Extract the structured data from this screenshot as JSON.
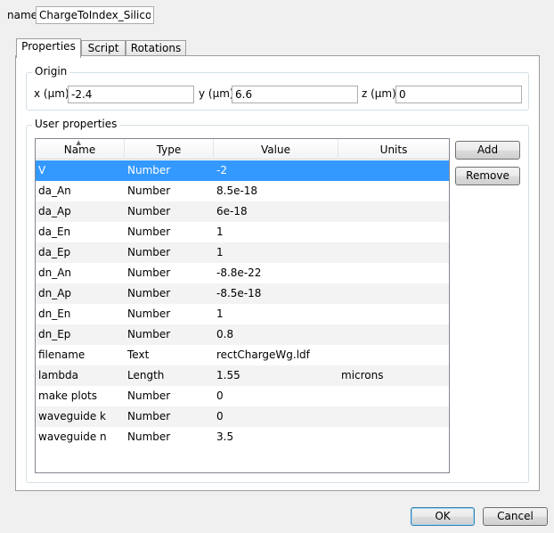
{
  "name": {
    "label": "name",
    "value": "ChargeToIndex_Silicon"
  },
  "tabs": [
    {
      "label": "Properties"
    },
    {
      "label": "Script"
    },
    {
      "label": "Rotations"
    }
  ],
  "origin": {
    "title": "Origin",
    "x": {
      "label": "x (µm)",
      "value": "-2.4"
    },
    "y": {
      "label": "y (µm)",
      "value": "6.6"
    },
    "z": {
      "label": "z (µm)",
      "value": "0"
    }
  },
  "user_properties": {
    "title": "User properties",
    "columns": [
      "Name",
      "Type",
      "Value",
      "Units"
    ],
    "rows": [
      {
        "name": "V",
        "type": "Number",
        "value": "-2",
        "units": ""
      },
      {
        "name": "da_An",
        "type": "Number",
        "value": "8.5e-18",
        "units": ""
      },
      {
        "name": "da_Ap",
        "type": "Number",
        "value": "6e-18",
        "units": ""
      },
      {
        "name": "da_En",
        "type": "Number",
        "value": "1",
        "units": ""
      },
      {
        "name": "da_Ep",
        "type": "Number",
        "value": "1",
        "units": ""
      },
      {
        "name": "dn_An",
        "type": "Number",
        "value": "-8.8e-22",
        "units": ""
      },
      {
        "name": "dn_Ap",
        "type": "Number",
        "value": "-8.5e-18",
        "units": ""
      },
      {
        "name": "dn_En",
        "type": "Number",
        "value": "1",
        "units": ""
      },
      {
        "name": "dn_Ep",
        "type": "Number",
        "value": "0.8",
        "units": ""
      },
      {
        "name": "filename",
        "type": "Text",
        "value": "rectChargeWg.ldf",
        "units": ""
      },
      {
        "name": "lambda",
        "type": "Length",
        "value": "1.55",
        "units": "microns"
      },
      {
        "name": "make plots",
        "type": "Number",
        "value": "0",
        "units": ""
      },
      {
        "name": "waveguide k",
        "type": "Number",
        "value": "0",
        "units": ""
      },
      {
        "name": "waveguide n",
        "type": "Number",
        "value": "3.5",
        "units": ""
      }
    ],
    "add_label": "Add",
    "remove_label": "Remove"
  },
  "footer": {
    "ok_label": "OK",
    "cancel_label": "Cancel"
  }
}
